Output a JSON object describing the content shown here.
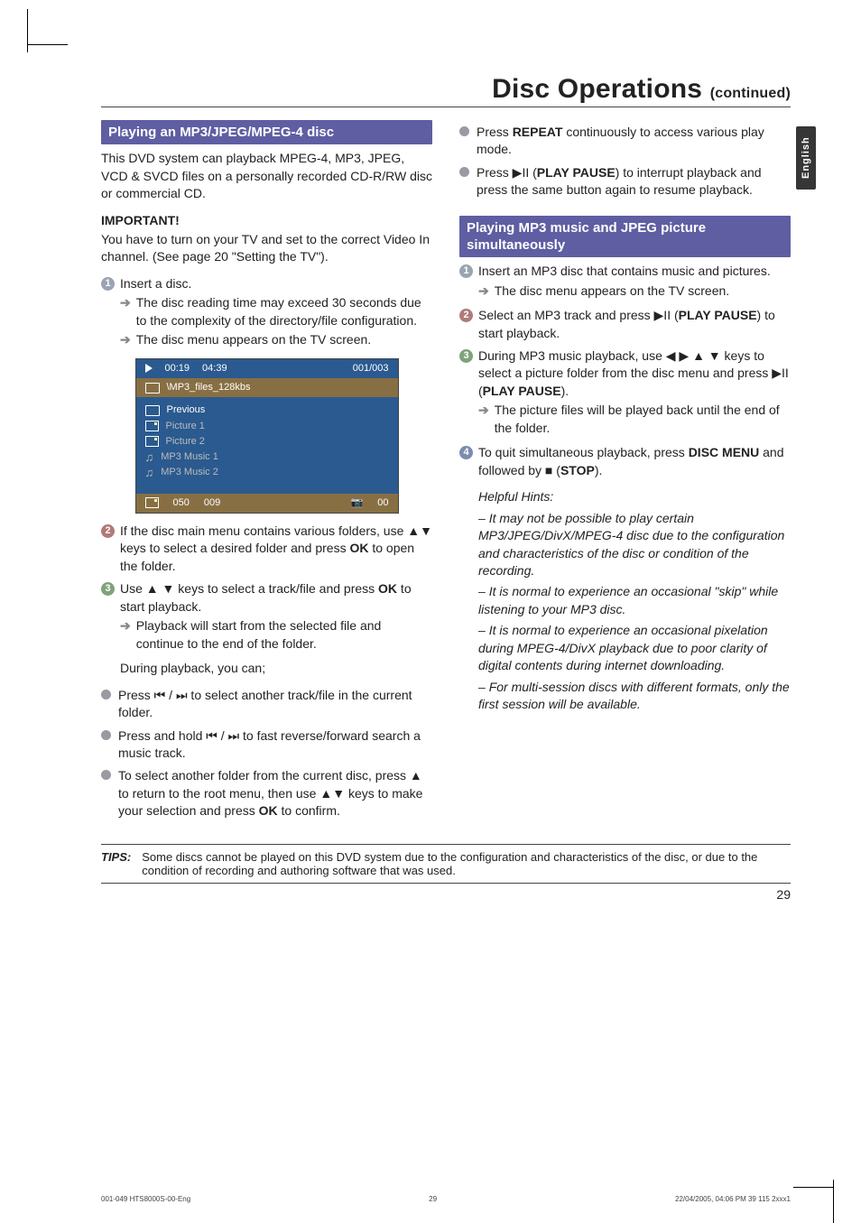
{
  "header": {
    "title_main": "Disc Operations",
    "title_sub": "(continued)"
  },
  "side_tab": "English",
  "left": {
    "section_head": "Playing an MP3/JPEG/MPEG-4 disc",
    "intro": "This DVD system can playback MPEG-4, MP3, JPEG, VCD & SVCD files on a personally recorded CD-R/RW disc or commercial CD.",
    "important_label": "IMPORTANT!",
    "important_body": "You have to turn on your TV and set to the correct Video In channel.  (See page 20 \"Setting the TV\").",
    "step1_head": "Insert a disc.",
    "step1_arrow_a": "The disc reading time may exceed 30 seconds due to the complexity of the directory/file configuration.",
    "step1_arrow_b": "The disc menu appears on the TV screen.",
    "osd": {
      "top_time_a": "00:19",
      "top_time_b": "04:39",
      "top_index": "001/003",
      "path": "\\MP3_files_128kbs",
      "items": [
        {
          "type": "folder",
          "label": "Previous",
          "sel": true
        },
        {
          "type": "pic",
          "label": "Picture 1"
        },
        {
          "type": "pic",
          "label": "Picture 2"
        },
        {
          "type": "music",
          "label": "MP3 Music 1"
        },
        {
          "type": "music",
          "label": "MP3 Music 2"
        }
      ],
      "foot_a": "050",
      "foot_b": "009",
      "foot_c": "00"
    },
    "step2": "If the disc main menu contains various folders, use ▲▼ keys to select a desired folder and press OK to open the folder.",
    "step3_a": "Use ▲ ▼ keys to select a track/file and press OK to start playback.",
    "step3_arrow": "Playback will start from the selected file and continue to the end of the folder.",
    "during": "During playback, you can;",
    "b1": "Press ◂◂ / ▸▸ to select another track/file in the current folder.",
    "b2": "Press and hold ◂◂ / ▸▸ to fast reverse/forward search a music track.",
    "b3": "To select another folder from the current disc, press ▲ to return to the root menu, then use ▲▼ keys to make your selection and press OK to confirm."
  },
  "right": {
    "b1_a": "Press ",
    "b1_b": "REPEAT",
    "b1_c": " continuously to access various play mode.",
    "b2_a": "Press ▶II (",
    "b2_b": "PLAY PAUSE",
    "b2_c": ") to interrupt playback and press the same button again to resume playback.",
    "section_head": "Playing MP3 music and JPEG picture simultaneously",
    "step1_a": "Insert an MP3 disc that contains music and pictures.",
    "step1_arrow": "The disc menu appears on the TV screen.",
    "step2": "Select an MP3 track and press ▶II (PLAY PAUSE) to start playback.",
    "step3_a": "During MP3 music playback, use ◀ ▶ ▲ ▼ keys to select a picture folder from the disc menu and press ▶II (PLAY PAUSE).",
    "step3_arrow": "The picture files will be played back until the end of the folder.",
    "step4": "To quit simultaneous playback, press DISC MENU and followed by ■ (STOP).",
    "hints_label": "Helpful Hints:",
    "hints": [
      "It may not be possible to play certain MP3/JPEG/DivX/MPEG-4 disc due to the configuration and characteristics of the disc or condition of the recording.",
      "It is normal to experience an occasional \"skip\" while listening to your MP3 disc.",
      "It is normal to experience an occasional pixelation during MPEG-4/DivX playback due to poor clarity of digital contents during internet downloading.",
      "For multi-session discs with different formats, only the first session will be available."
    ]
  },
  "tips": {
    "label": "TIPS:",
    "body": "Some discs cannot be played on this DVD system due to the configuration and characteristics of the disc, or due to the condition of recording and authoring software that was used."
  },
  "page_number": "29",
  "footer": {
    "left": "001-049 HTS8000S-00-Eng",
    "mid": "29",
    "right": "22/04/2005, 04:06 PM 39 115 2xxx1"
  }
}
